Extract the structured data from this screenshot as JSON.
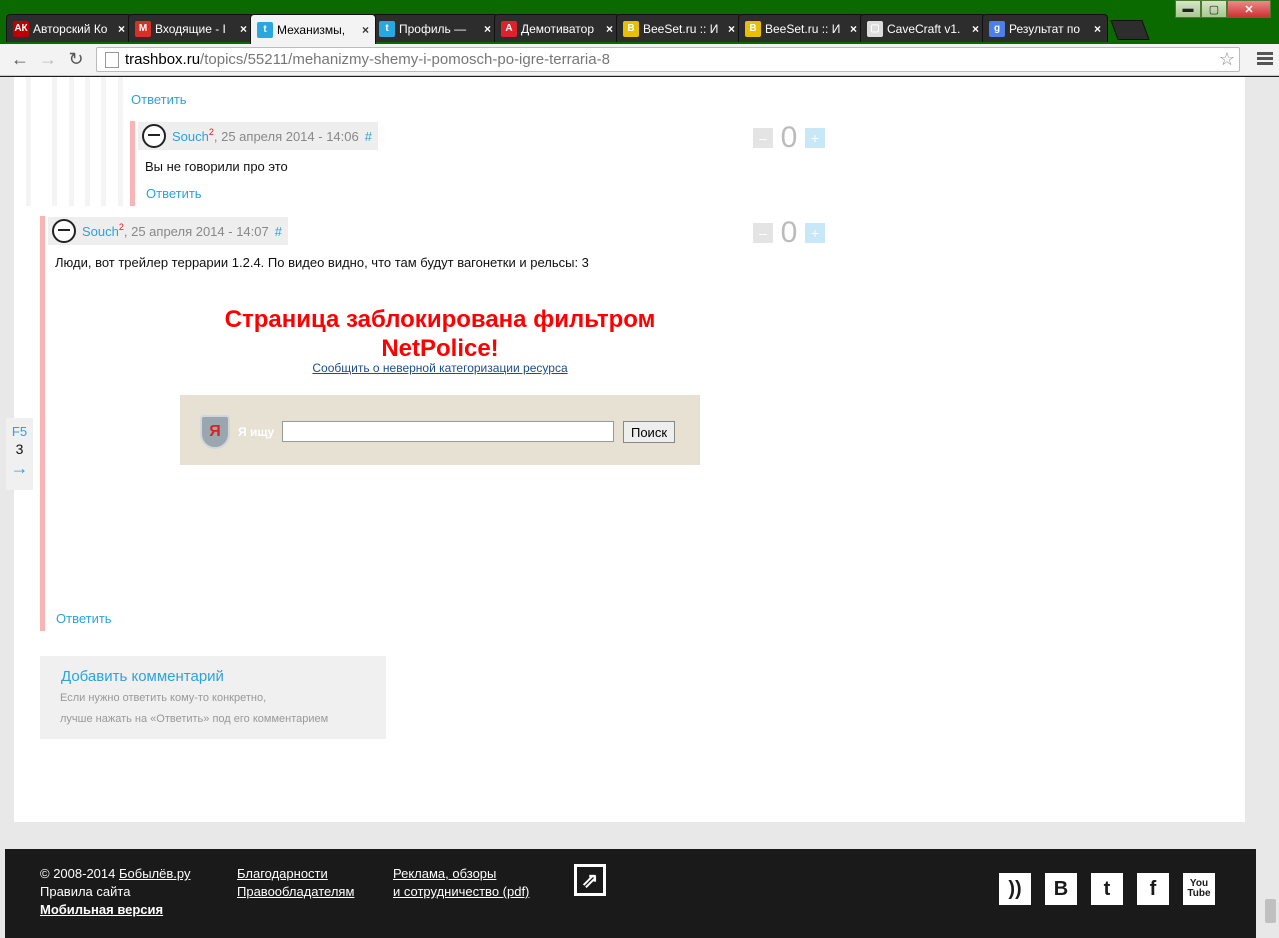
{
  "browser": {
    "tabs": [
      {
        "title": "Авторский Ко",
        "favicon": "АК",
        "color": "#c00000",
        "active": false
      },
      {
        "title": "Входящие - I",
        "favicon": "M",
        "color": "#d93025",
        "active": false
      },
      {
        "title": "Механизмы,",
        "favicon": "t",
        "color": "#29a8e0",
        "active": true
      },
      {
        "title": "Профиль —",
        "favicon": "t",
        "color": "#29a8e0",
        "active": false
      },
      {
        "title": "Демотиватор",
        "favicon": "A",
        "color": "#e0202a",
        "active": false
      },
      {
        "title": "BeeSet.ru :: И",
        "favicon": "B",
        "color": "#e8c000",
        "active": false
      },
      {
        "title": "BeeSet.ru :: И",
        "favicon": "B",
        "color": "#e8c000",
        "active": false
      },
      {
        "title": "CaveCraft v1.",
        "favicon": "▢",
        "color": "#dddddd",
        "active": false
      },
      {
        "title": "Результат по",
        "favicon": "g",
        "color": "#4a80e8",
        "active": false
      }
    ],
    "tab_close_glyph": "×",
    "window_controls": {
      "minimize": "▬",
      "maximize": "▢",
      "close": "✕"
    },
    "nav": {
      "back": "←",
      "forward": "→",
      "reload": "↻"
    },
    "url_host": "trashbox.ru",
    "url_path": "/topics/55211/mehanizmy-shemy-i-pomosch-po-igre-terraria-8",
    "star": "☆"
  },
  "comments": {
    "reply_label": "Ответить",
    "c1": {
      "author": "Souch",
      "rank": "2",
      "date": ", 25 апреля 2014 - 14:06",
      "hash": "#",
      "text": "Вы не говорили про это",
      "score": "0"
    },
    "c2": {
      "author": "Souch",
      "rank": "2",
      "date": ", 25 апреля 2014 - 14:07",
      "hash": "#",
      "text": "Люди, вот трейлер террарии 1.2.4. По видео видно, что там будут вагонетки и рельсы: 3",
      "score": "0"
    },
    "vote_minus": "–",
    "vote_plus": "+"
  },
  "blocked": {
    "title_line1": "Страница заблокирована фильтром",
    "title_line2": "NetPolice!",
    "report_link": "Сообщить о неверной категоризации ресурса",
    "search_label": "Я ищу",
    "search_value": "",
    "search_button": "Поиск",
    "shield_letter": "Я"
  },
  "f5_widget": {
    "label": "F5",
    "count": "3",
    "arrow": "→"
  },
  "add_comment": {
    "title": "Добавить комментарий",
    "hint_line1": "Если нужно ответить кому-то конкретно,",
    "hint_line2": "лучше нажать на «Ответить» под его комментарием"
  },
  "footer": {
    "copyright_prefix": "© 2008-2014 ",
    "copyright_link": "Бобылёв.ру",
    "rules": "Правила сайта",
    "mobile": "Мобильная версия",
    "thanks": "Благодарности",
    "rightholders": "Правообладателям",
    "ads_line1": "Реклама, обзоры",
    "ads_line2": "и сотрудничество (pdf)",
    "share_glyph": "⇗",
    "social": {
      "rss": "))",
      "vk": "B",
      "twitter": "t",
      "facebook": "f",
      "youtube_1": "You",
      "youtube_2": "Tube"
    }
  }
}
